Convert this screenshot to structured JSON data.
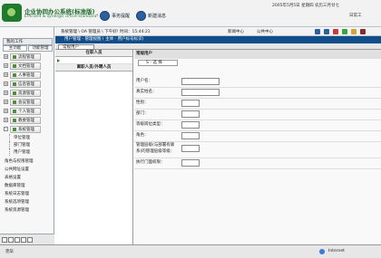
{
  "header": {
    "app_name": "企业协同办公系统(标准版)",
    "app_subtitle": "Efficient & synergic office-standard!",
    "buttons": [
      {
        "label": "事务提醒",
        "icon": "bell-icon"
      },
      {
        "label": "新建消息",
        "icon": "mail-icon"
      }
    ],
    "datetime": "2005年5月5日 星期四 农历三月廿七",
    "top_link": "日常工"
  },
  "left_panel": {
    "header": "我的工作",
    "tabs": [
      "主功能",
      "功能管理"
    ],
    "nav_items": [
      {
        "label": "流程管理",
        "expanded": false
      },
      {
        "label": "文档管理",
        "expanded": false
      },
      {
        "label": "人事管理",
        "expanded": false
      },
      {
        "label": "信息管理",
        "expanded": false
      },
      {
        "label": "资源管理",
        "expanded": false
      },
      {
        "label": "会议管理",
        "expanded": false
      },
      {
        "label": "个人管理",
        "expanded": false
      },
      {
        "label": "教委管理",
        "expanded": false
      },
      {
        "label": "系统管理",
        "expanded": true
      }
    ],
    "sub_items": [
      "单位管理",
      "部门管理",
      "用户管理"
    ],
    "extra_items": [
      "角色与权限管理",
      "公共网址设置",
      "表格设置",
      "数据库管理",
      "系统日志管理",
      "系统选项管理",
      "系统资源管理"
    ]
  },
  "breadcrumb": "系统管理 \\ OA 管理员 \\ 下午好! 时间：15:44:21",
  "toolbar_labels": {
    "news_center": "新闻中心",
    "public_center": "公共中心"
  },
  "blue_bar": "用户管理 - 管理视图 ( 主体 - 用户标号标识)",
  "tab_label": "常规用户",
  "col_headers": [
    "在职人员",
    "离职人员/外聘人员"
  ],
  "form": {
    "title": "常规用户",
    "selector_value": "S - 选 择",
    "fields": [
      {
        "label": "用户名：",
        "type": "input"
      },
      {
        "label": "真实姓名：",
        "type": "input"
      },
      {
        "label": "性别：",
        "type": "select"
      },
      {
        "label": "部门：",
        "type": "select"
      },
      {
        "label": "等级岗位类型：",
        "type": "select"
      },
      {
        "label": "角色：",
        "type": "select"
      },
      {
        "label": "管理层级(与部署有联系)的管理层级等级：",
        "type": "select"
      },
      {
        "label": "执行门面权限：",
        "type": "select"
      }
    ]
  },
  "status": {
    "left": "完毕",
    "right": "Internet"
  }
}
